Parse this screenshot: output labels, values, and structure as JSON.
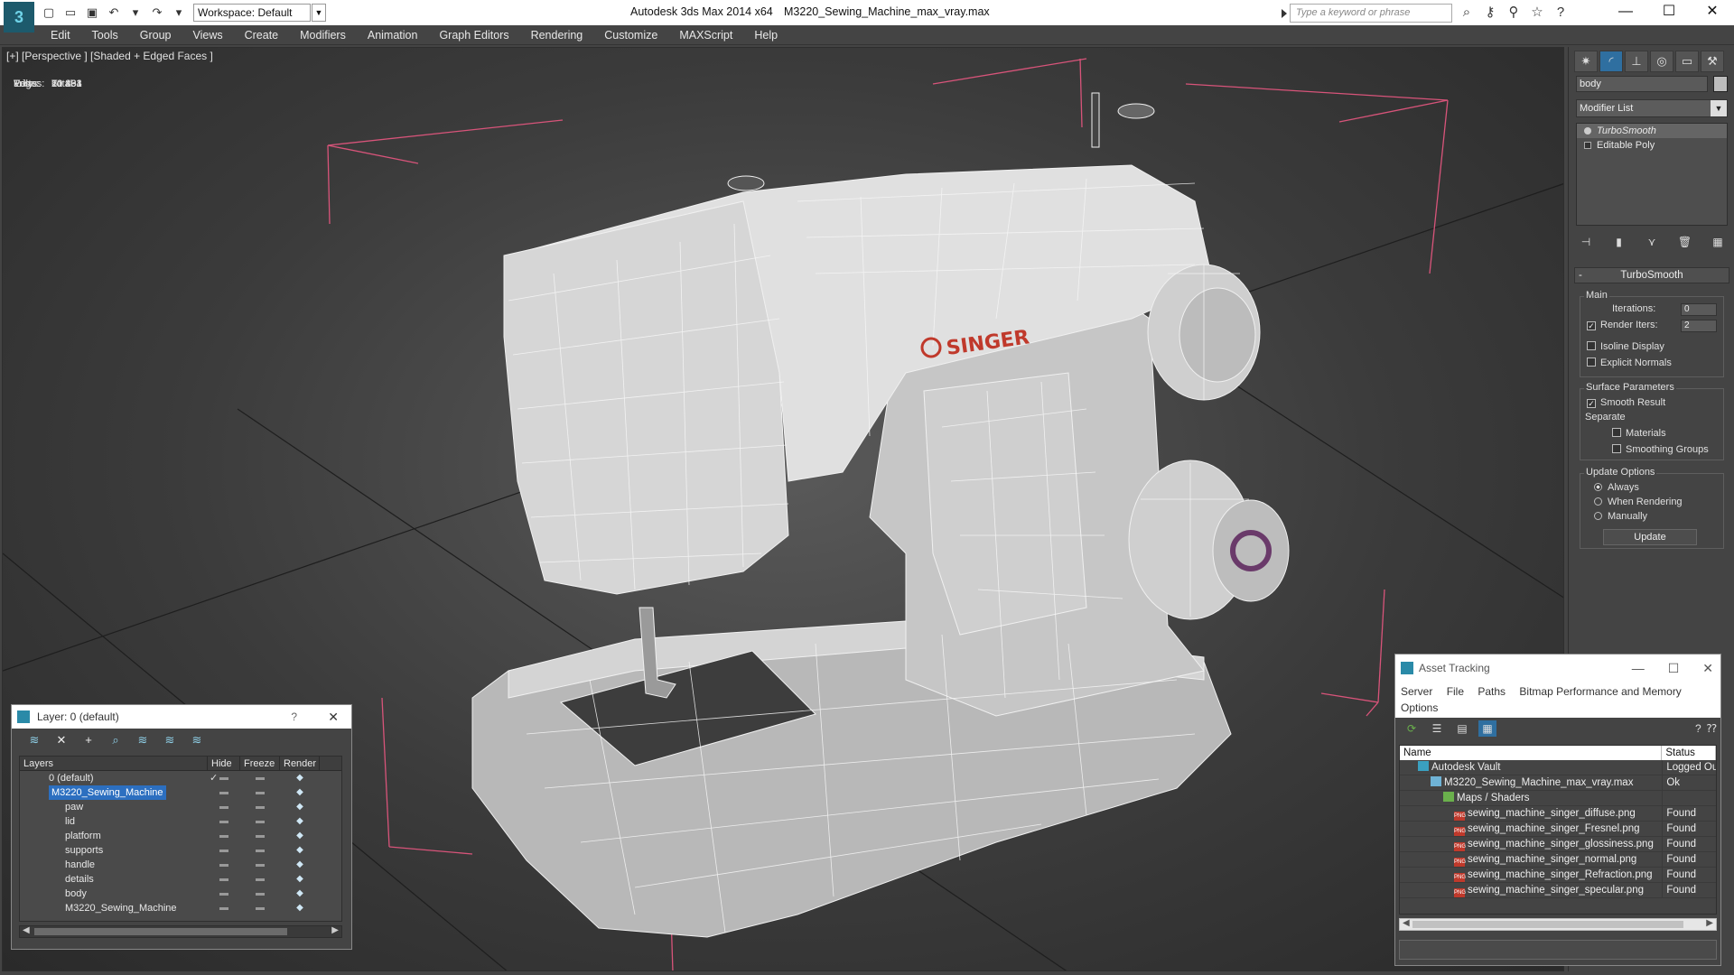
{
  "titlebar": {
    "workspace": "Workspace: Default",
    "app_title": "Autodesk 3ds Max  2014 x64",
    "file_title": "M3220_Sewing_Machine_max_vray.max",
    "search_placeholder": "Type a keyword or phrase"
  },
  "menu": [
    "Edit",
    "Tools",
    "Group",
    "Views",
    "Create",
    "Modifiers",
    "Animation",
    "Graph Editors",
    "Rendering",
    "Customize",
    "MAXScript",
    "Help"
  ],
  "viewport": {
    "label": "[+] [Perspective ] [Shaded + Edged Faces ]",
    "stats": {
      "header": "Total",
      "rows": [
        {
          "label": "Polys:",
          "value": "20 431"
        },
        {
          "label": "Tris:",
          "value": "20 431"
        },
        {
          "label": "Edges:",
          "value": "61 293"
        },
        {
          "label": "Verts:",
          "value": "10 364"
        }
      ]
    },
    "brand_text": "SINGER"
  },
  "command_panel": {
    "object_name": "body",
    "modifier_list": "Modifier List",
    "stack": [
      "TurboSmooth",
      "Editable Poly"
    ],
    "turbosmooth": {
      "title": "TurboSmooth",
      "main": "Main",
      "iterations_label": "Iterations:",
      "iterations_value": "0",
      "render_iters_label": "Render Iters:",
      "render_iters_value": "2",
      "isoline": "Isoline Display",
      "explicit": "Explicit Normals",
      "surface": "Surface Parameters",
      "smooth_result": "Smooth Result",
      "separate": "Separate",
      "materials": "Materials",
      "smoothing_groups": "Smoothing Groups",
      "update_options": "Update Options",
      "always": "Always",
      "when_rendering": "When Rendering",
      "manually": "Manually",
      "update_btn": "Update"
    }
  },
  "layer_dialog": {
    "title": "Layer: 0 (default)",
    "columns": [
      "Layers",
      "Hide",
      "Freeze",
      "Render"
    ],
    "rows": [
      {
        "name": "0 (default)",
        "indent": 1
      },
      {
        "name": "M3220_Sewing_Machine",
        "indent": 1,
        "selected": true
      },
      {
        "name": "paw",
        "indent": 2
      },
      {
        "name": "lid",
        "indent": 2
      },
      {
        "name": "platform",
        "indent": 2
      },
      {
        "name": "supports",
        "indent": 2
      },
      {
        "name": "handle",
        "indent": 2
      },
      {
        "name": "details",
        "indent": 2
      },
      {
        "name": "body",
        "indent": 2
      },
      {
        "name": "M3220_Sewing_Machine",
        "indent": 2
      }
    ]
  },
  "asset_dialog": {
    "title": "Asset Tracking",
    "menu": [
      "Server",
      "File",
      "Paths",
      "Bitmap Performance and Memory",
      "Options"
    ],
    "columns": [
      "Name",
      "Status"
    ],
    "rows": [
      {
        "name": "Autodesk Vault",
        "status": "Logged Out",
        "indent": 1,
        "icon": "vault"
      },
      {
        "name": "M3220_Sewing_Machine_max_vray.max",
        "status": "Ok",
        "indent": 2,
        "icon": "file"
      },
      {
        "name": "Maps / Shaders",
        "status": "",
        "indent": 3,
        "icon": "maps"
      },
      {
        "name": "sewing_machine_singer_diffuse.png",
        "status": "Found",
        "indent": 4,
        "icon": "png"
      },
      {
        "name": "sewing_machine_singer_Fresnel.png",
        "status": "Found",
        "indent": 4,
        "icon": "png"
      },
      {
        "name": "sewing_machine_singer_glossiness.png",
        "status": "Found",
        "indent": 4,
        "icon": "png"
      },
      {
        "name": "sewing_machine_singer_normal.png",
        "status": "Found",
        "indent": 4,
        "icon": "png"
      },
      {
        "name": "sewing_machine_singer_Refraction.png",
        "status": "Found",
        "indent": 4,
        "icon": "png"
      },
      {
        "name": "sewing_machine_singer_specular.png",
        "status": "Found",
        "indent": 4,
        "icon": "png"
      }
    ]
  }
}
